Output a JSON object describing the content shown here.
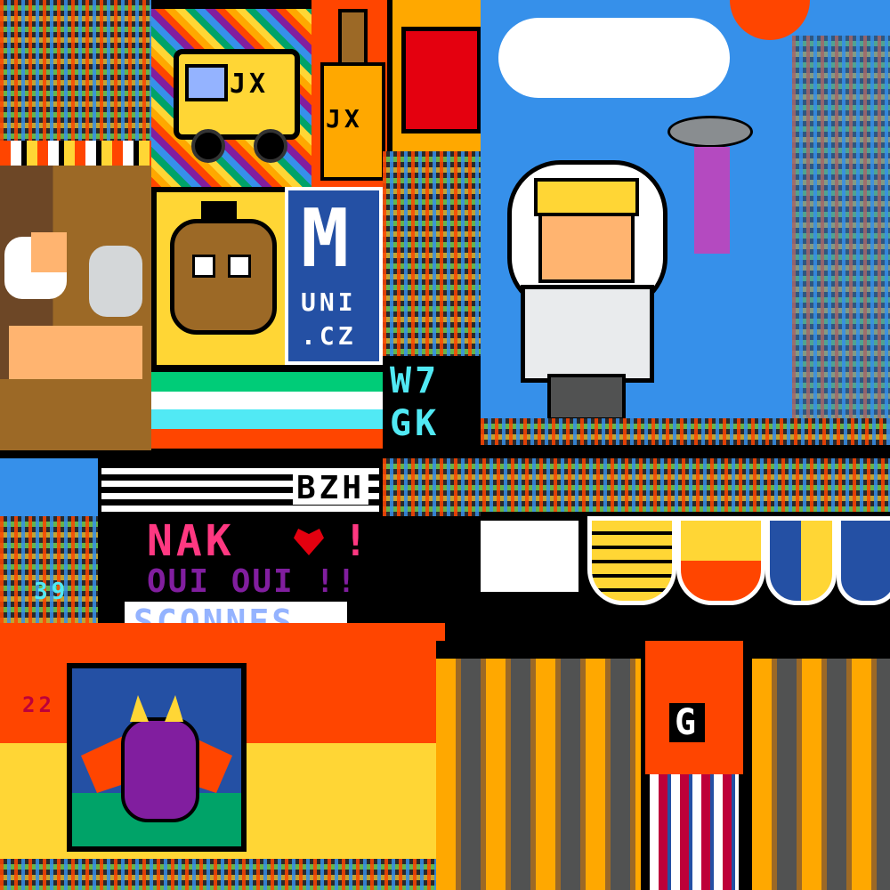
{
  "artworks": {
    "truck_text": "JX",
    "bottle_text": "JX",
    "muni_big": "M",
    "muni_line1": "UNI",
    "muni_line2": ".CZ",
    "w7_line1": "W7",
    "w7_line2": "GK",
    "bzh_text": "BZH",
    "nak_text": "NAK",
    "nak_suffix": "!",
    "ouioui_text": "OUI OUI !!",
    "sconnes_text": "SCONNES",
    "badge_39": "39",
    "g_letter": "G",
    "small_22": "22"
  },
  "colors": {
    "sky": "#3690ea",
    "orange": "#ff4500",
    "yellow": "#ffd635",
    "navy": "#2450a4",
    "purple": "#811e9f",
    "green": "#00a368",
    "black": "#000000",
    "white": "#ffffff",
    "gold": "#ffa800",
    "brown": "#9c6926"
  }
}
